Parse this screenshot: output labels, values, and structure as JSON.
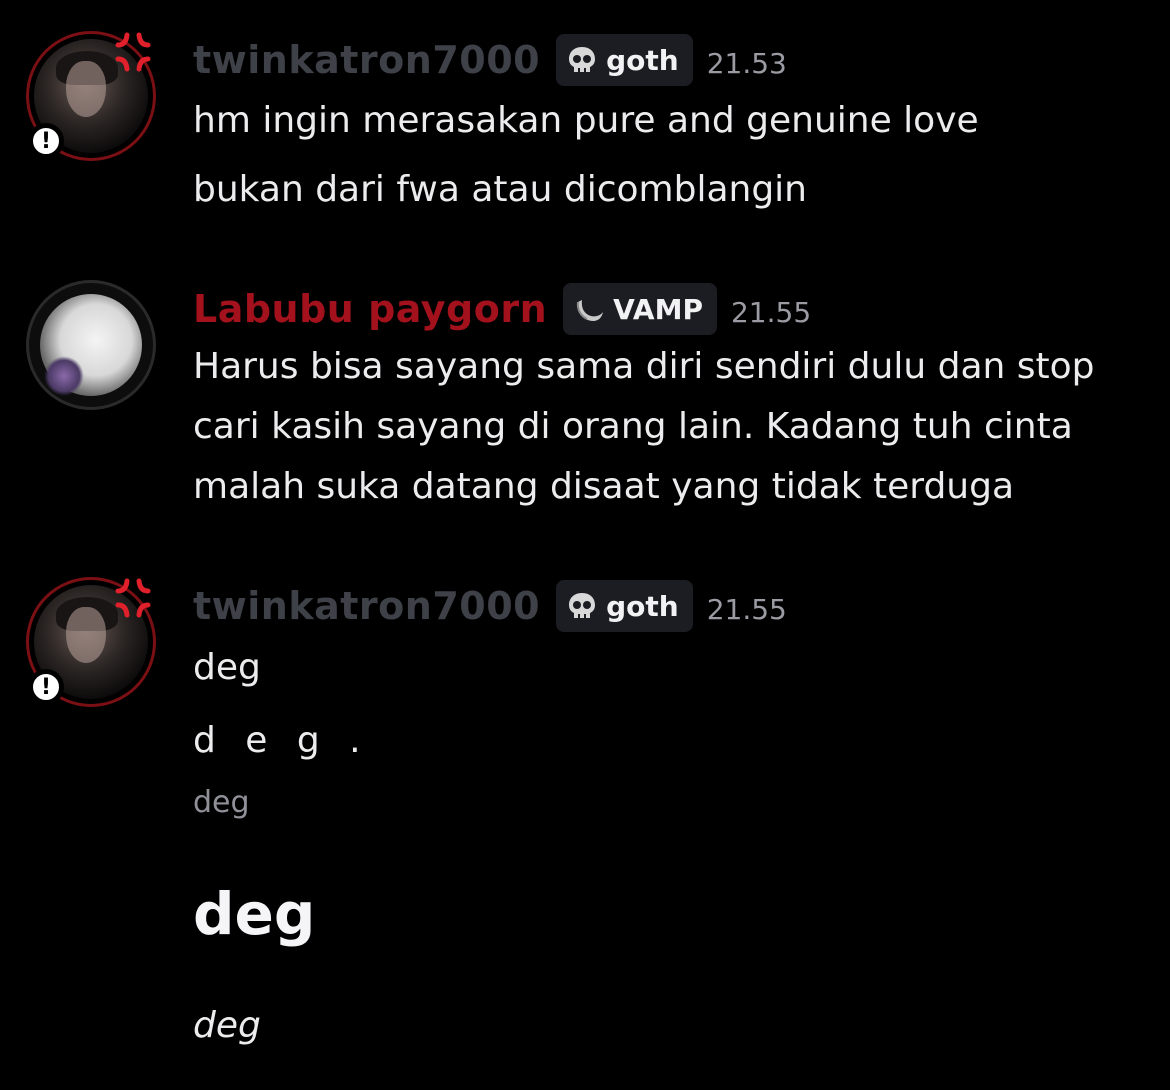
{
  "messages": [
    {
      "username": "twinkatron7000",
      "tag": "goth",
      "tag_icon": "skull-icon",
      "time": "21.53",
      "lines": [
        "hm ingin merasakan pure and genuine love",
        "bukan dari fwa atau dicomblangin"
      ]
    },
    {
      "username": "Labubu paygorn",
      "tag": "VAMP",
      "tag_icon": "moon-icon",
      "time": "21.55",
      "lines": [
        "Harus bisa sayang sama diri sendiri dulu dan stop",
        "cari kasih sayang di orang lain. Kadang tuh cinta",
        "malah suka datang disaat yang tidak terduga"
      ]
    },
    {
      "username": "twinkatron7000",
      "tag": "goth",
      "tag_icon": "skull-icon",
      "time": "21.55",
      "lines": [
        "deg",
        "d e g .",
        "deg",
        "deg",
        "deg"
      ]
    }
  ],
  "colors": {
    "background": "#000000",
    "username_grey": "#3f4149",
    "username_red": "#a3111c",
    "tag_bg": "#1c1d22",
    "timestamp": "#9a9ba3",
    "subtext": "#8f9098"
  },
  "badges": {
    "alert": "!"
  }
}
